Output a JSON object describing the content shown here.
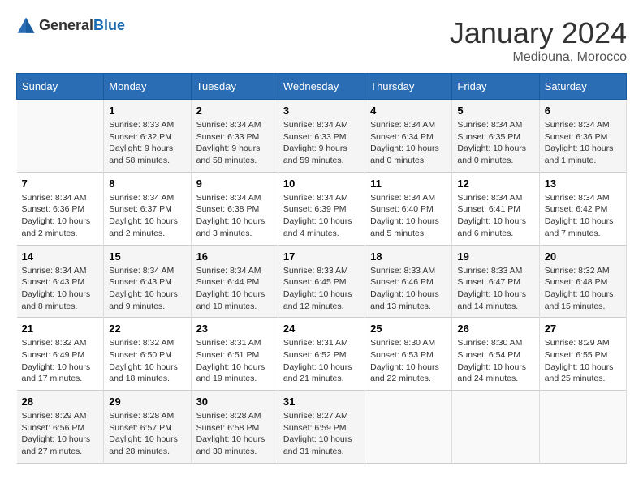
{
  "header": {
    "logo_general": "General",
    "logo_blue": "Blue",
    "title": "January 2024",
    "location": "Mediouna, Morocco"
  },
  "weekdays": [
    "Sunday",
    "Monday",
    "Tuesday",
    "Wednesday",
    "Thursday",
    "Friday",
    "Saturday"
  ],
  "weeks": [
    [
      {
        "day": "",
        "sunrise": "",
        "sunset": "",
        "daylight": ""
      },
      {
        "day": "1",
        "sunrise": "Sunrise: 8:33 AM",
        "sunset": "Sunset: 6:32 PM",
        "daylight": "Daylight: 9 hours and 58 minutes."
      },
      {
        "day": "2",
        "sunrise": "Sunrise: 8:34 AM",
        "sunset": "Sunset: 6:33 PM",
        "daylight": "Daylight: 9 hours and 58 minutes."
      },
      {
        "day": "3",
        "sunrise": "Sunrise: 8:34 AM",
        "sunset": "Sunset: 6:33 PM",
        "daylight": "Daylight: 9 hours and 59 minutes."
      },
      {
        "day": "4",
        "sunrise": "Sunrise: 8:34 AM",
        "sunset": "Sunset: 6:34 PM",
        "daylight": "Daylight: 10 hours and 0 minutes."
      },
      {
        "day": "5",
        "sunrise": "Sunrise: 8:34 AM",
        "sunset": "Sunset: 6:35 PM",
        "daylight": "Daylight: 10 hours and 0 minutes."
      },
      {
        "day": "6",
        "sunrise": "Sunrise: 8:34 AM",
        "sunset": "Sunset: 6:36 PM",
        "daylight": "Daylight: 10 hours and 1 minute."
      }
    ],
    [
      {
        "day": "7",
        "sunrise": "Sunrise: 8:34 AM",
        "sunset": "Sunset: 6:36 PM",
        "daylight": "Daylight: 10 hours and 2 minutes."
      },
      {
        "day": "8",
        "sunrise": "Sunrise: 8:34 AM",
        "sunset": "Sunset: 6:37 PM",
        "daylight": "Daylight: 10 hours and 2 minutes."
      },
      {
        "day": "9",
        "sunrise": "Sunrise: 8:34 AM",
        "sunset": "Sunset: 6:38 PM",
        "daylight": "Daylight: 10 hours and 3 minutes."
      },
      {
        "day": "10",
        "sunrise": "Sunrise: 8:34 AM",
        "sunset": "Sunset: 6:39 PM",
        "daylight": "Daylight: 10 hours and 4 minutes."
      },
      {
        "day": "11",
        "sunrise": "Sunrise: 8:34 AM",
        "sunset": "Sunset: 6:40 PM",
        "daylight": "Daylight: 10 hours and 5 minutes."
      },
      {
        "day": "12",
        "sunrise": "Sunrise: 8:34 AM",
        "sunset": "Sunset: 6:41 PM",
        "daylight": "Daylight: 10 hours and 6 minutes."
      },
      {
        "day": "13",
        "sunrise": "Sunrise: 8:34 AM",
        "sunset": "Sunset: 6:42 PM",
        "daylight": "Daylight: 10 hours and 7 minutes."
      }
    ],
    [
      {
        "day": "14",
        "sunrise": "Sunrise: 8:34 AM",
        "sunset": "Sunset: 6:43 PM",
        "daylight": "Daylight: 10 hours and 8 minutes."
      },
      {
        "day": "15",
        "sunrise": "Sunrise: 8:34 AM",
        "sunset": "Sunset: 6:43 PM",
        "daylight": "Daylight: 10 hours and 9 minutes."
      },
      {
        "day": "16",
        "sunrise": "Sunrise: 8:34 AM",
        "sunset": "Sunset: 6:44 PM",
        "daylight": "Daylight: 10 hours and 10 minutes."
      },
      {
        "day": "17",
        "sunrise": "Sunrise: 8:33 AM",
        "sunset": "Sunset: 6:45 PM",
        "daylight": "Daylight: 10 hours and 12 minutes."
      },
      {
        "day": "18",
        "sunrise": "Sunrise: 8:33 AM",
        "sunset": "Sunset: 6:46 PM",
        "daylight": "Daylight: 10 hours and 13 minutes."
      },
      {
        "day": "19",
        "sunrise": "Sunrise: 8:33 AM",
        "sunset": "Sunset: 6:47 PM",
        "daylight": "Daylight: 10 hours and 14 minutes."
      },
      {
        "day": "20",
        "sunrise": "Sunrise: 8:32 AM",
        "sunset": "Sunset: 6:48 PM",
        "daylight": "Daylight: 10 hours and 15 minutes."
      }
    ],
    [
      {
        "day": "21",
        "sunrise": "Sunrise: 8:32 AM",
        "sunset": "Sunset: 6:49 PM",
        "daylight": "Daylight: 10 hours and 17 minutes."
      },
      {
        "day": "22",
        "sunrise": "Sunrise: 8:32 AM",
        "sunset": "Sunset: 6:50 PM",
        "daylight": "Daylight: 10 hours and 18 minutes."
      },
      {
        "day": "23",
        "sunrise": "Sunrise: 8:31 AM",
        "sunset": "Sunset: 6:51 PM",
        "daylight": "Daylight: 10 hours and 19 minutes."
      },
      {
        "day": "24",
        "sunrise": "Sunrise: 8:31 AM",
        "sunset": "Sunset: 6:52 PM",
        "daylight": "Daylight: 10 hours and 21 minutes."
      },
      {
        "day": "25",
        "sunrise": "Sunrise: 8:30 AM",
        "sunset": "Sunset: 6:53 PM",
        "daylight": "Daylight: 10 hours and 22 minutes."
      },
      {
        "day": "26",
        "sunrise": "Sunrise: 8:30 AM",
        "sunset": "Sunset: 6:54 PM",
        "daylight": "Daylight: 10 hours and 24 minutes."
      },
      {
        "day": "27",
        "sunrise": "Sunrise: 8:29 AM",
        "sunset": "Sunset: 6:55 PM",
        "daylight": "Daylight: 10 hours and 25 minutes."
      }
    ],
    [
      {
        "day": "28",
        "sunrise": "Sunrise: 8:29 AM",
        "sunset": "Sunset: 6:56 PM",
        "daylight": "Daylight: 10 hours and 27 minutes."
      },
      {
        "day": "29",
        "sunrise": "Sunrise: 8:28 AM",
        "sunset": "Sunset: 6:57 PM",
        "daylight": "Daylight: 10 hours and 28 minutes."
      },
      {
        "day": "30",
        "sunrise": "Sunrise: 8:28 AM",
        "sunset": "Sunset: 6:58 PM",
        "daylight": "Daylight: 10 hours and 30 minutes."
      },
      {
        "day": "31",
        "sunrise": "Sunrise: 8:27 AM",
        "sunset": "Sunset: 6:59 PM",
        "daylight": "Daylight: 10 hours and 31 minutes."
      },
      {
        "day": "",
        "sunrise": "",
        "sunset": "",
        "daylight": ""
      },
      {
        "day": "",
        "sunrise": "",
        "sunset": "",
        "daylight": ""
      },
      {
        "day": "",
        "sunrise": "",
        "sunset": "",
        "daylight": ""
      }
    ]
  ]
}
